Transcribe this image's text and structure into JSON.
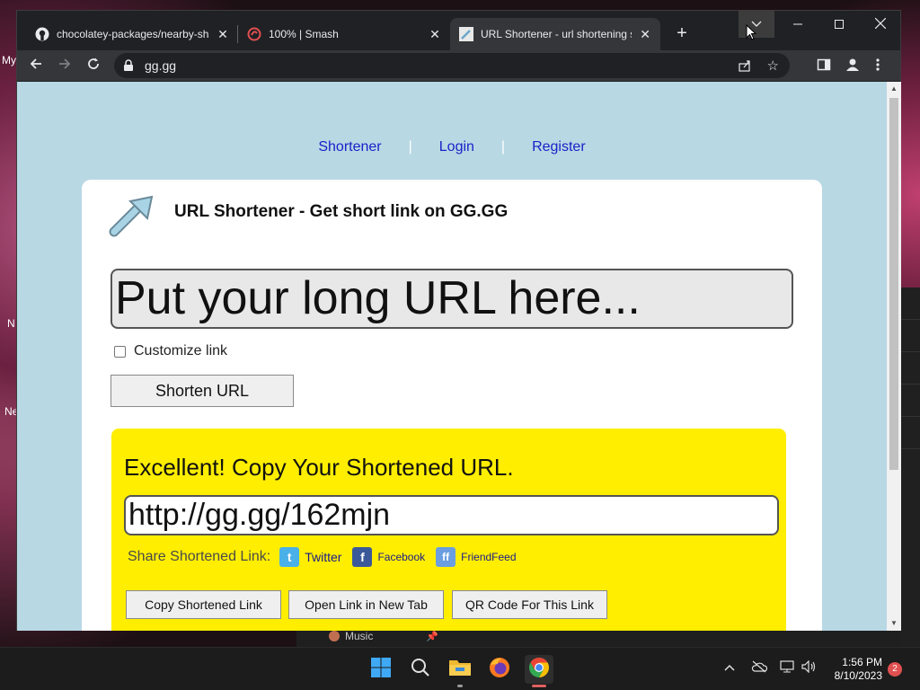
{
  "desktop": {
    "labels": [
      "My",
      "N",
      "Ne"
    ]
  },
  "browser": {
    "tabs": [
      {
        "title": "chocolatey-packages/nearby-sha",
        "icon": "github-icon",
        "active": false
      },
      {
        "title": "100% | Smash",
        "icon": "smash-icon",
        "active": false
      },
      {
        "title": "URL Shortener - url shortening s",
        "icon": "url-shortener-favicon",
        "active": true
      }
    ],
    "address": "gg.gg"
  },
  "page": {
    "nav": {
      "shortener": "Shortener",
      "login": "Login",
      "register": "Register",
      "separator": "|"
    },
    "title": "URL Shortener - Get short link on GG.GG",
    "long_url_placeholder": "Put your long URL here...",
    "customize_label": "Customize link",
    "shorten_button": "Shorten URL",
    "result": {
      "heading": "Excellent! Copy Your Shortened URL.",
      "short_url": "http://gg.gg/162mjn",
      "share_label": "Share Shortened Link:",
      "share": {
        "twitter": "Twitter",
        "facebook": "Facebook",
        "friendfeed": "FriendFeed"
      },
      "buttons": {
        "copy": "Copy Shortened Link",
        "open": "Open Link in New Tab",
        "qr": "QR Code For This Link"
      }
    },
    "colors": {
      "background": "#b8d8e4",
      "result_bg": "#ffee00",
      "link": "#1a22c8"
    }
  },
  "behind_window": {
    "music_label": "Music"
  },
  "taskbar": {
    "time": "1:56 PM",
    "date": "8/10/2023",
    "notification_count": "2"
  }
}
